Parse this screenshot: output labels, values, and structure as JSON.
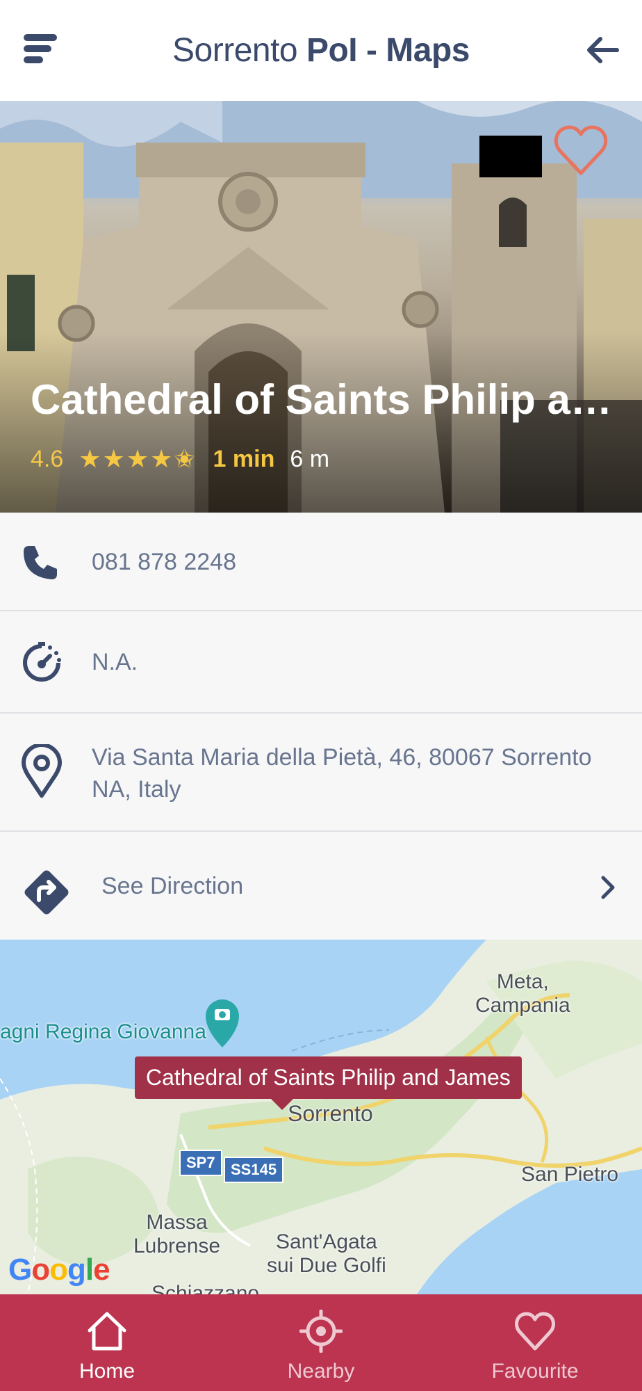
{
  "header": {
    "title_regular": "Sorrento ",
    "title_bold": "PoI - Maps"
  },
  "place": {
    "name": "Cathedral of Saints Philip and Ja...",
    "rating": "4.6",
    "stars": "★★★★✬",
    "rating_value": 4.6,
    "travel_time": "1 min",
    "distance": "6 m",
    "favorite": false
  },
  "details": {
    "phone": "081 878 2248",
    "hours": "N.A.",
    "address": "Via Santa Maria della Pietà, 46, 80067 Sorrento NA, Italy",
    "direction_label": "See Direction"
  },
  "map": {
    "callout": "Cathedral of Saints Philip and James",
    "labels": {
      "bagni": "agni Regina Giovanna",
      "meta": "Meta,\nCampania",
      "sorrento": "Sorrento",
      "san_pietro": "San Pietro",
      "massa": "Massa\nLubrense",
      "santagata": "Sant'Agata\nsui Due Golfi",
      "schiazzano": "Schiazzano"
    },
    "routes": [
      "SP7",
      "SS145"
    ],
    "attribution": "Google"
  },
  "nav": {
    "items": [
      {
        "label": "Home",
        "icon": "home-icon",
        "active": true
      },
      {
        "label": "Nearby",
        "icon": "crosshair-icon",
        "active": false
      },
      {
        "label": "Favourite",
        "icon": "heart-icon",
        "active": false
      }
    ]
  },
  "colors": {
    "primary": "#bc3450",
    "accent": "#f5c742",
    "text": "#3b4a6b",
    "heart": "#e8735e"
  }
}
